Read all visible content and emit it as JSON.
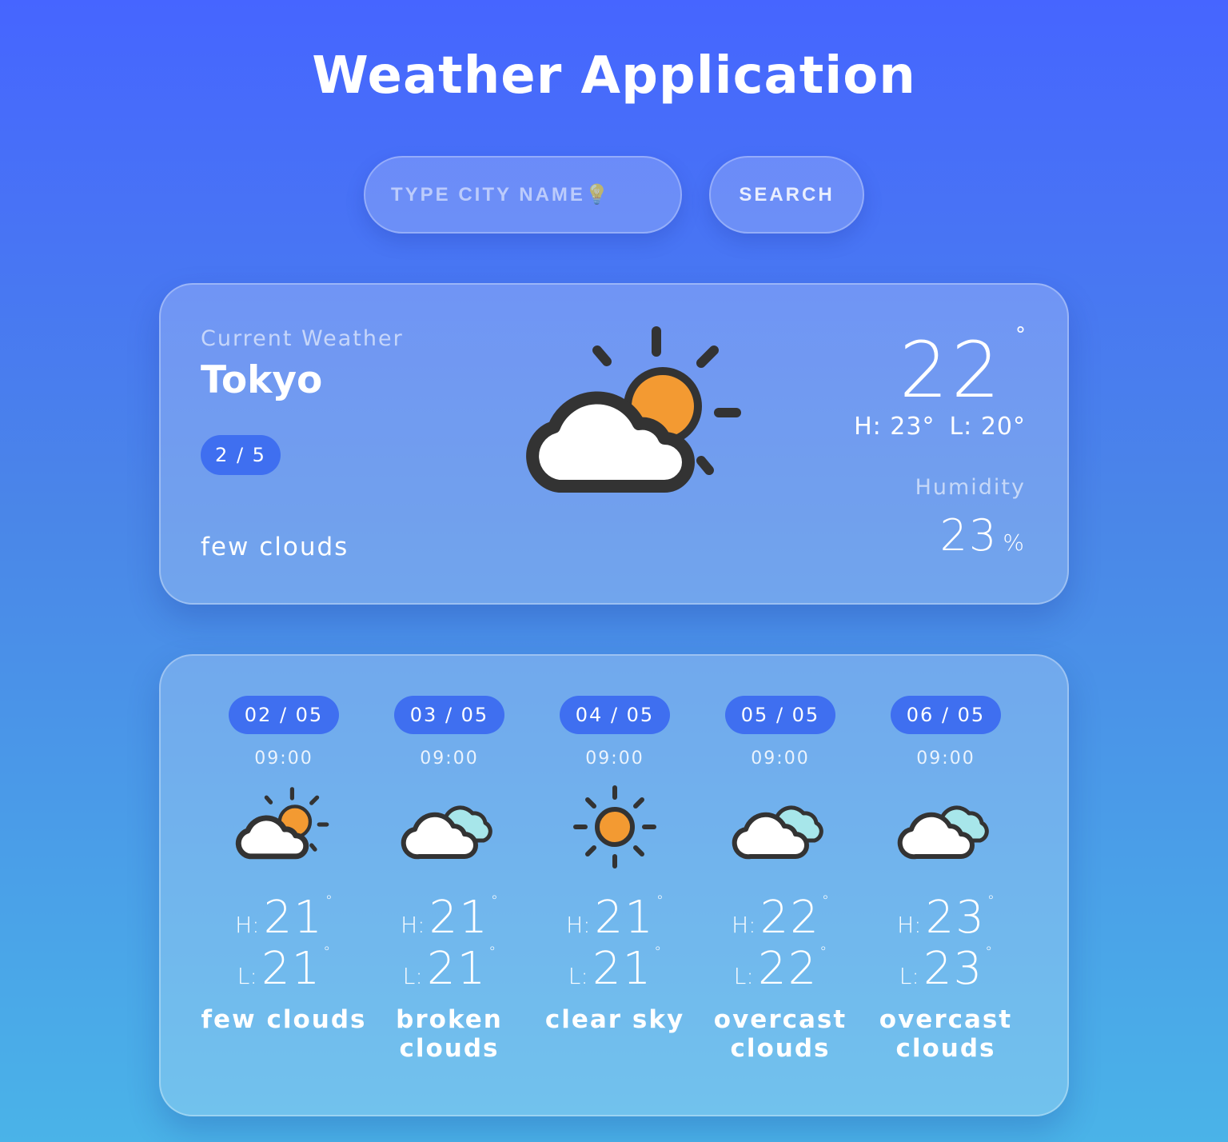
{
  "app": {
    "title": "Weather Application"
  },
  "search": {
    "placeholder": "TYPE CITY NAME💡",
    "button_label": "SEARCH"
  },
  "current": {
    "label": "Current Weather",
    "city": "Tokyo",
    "date": "2 / 5",
    "description": "few clouds",
    "icon": "partly-cloudy-icon",
    "temp": "22",
    "degree": "°",
    "high": "H: 23°",
    "low": "L: 20°",
    "humidity_label": "Humidity",
    "humidity_value": "23",
    "humidity_unit": "%"
  },
  "forecast": [
    {
      "date": "02 / 05",
      "time": "09:00",
      "icon": "partly-cloudy-icon",
      "high_label": "H:",
      "high": "21",
      "low_label": "L:",
      "low": "21",
      "deg": "°",
      "description": "few clouds"
    },
    {
      "date": "03 / 05",
      "time": "09:00",
      "icon": "broken-clouds-icon",
      "high_label": "H:",
      "high": "21",
      "low_label": "L:",
      "low": "21",
      "deg": "°",
      "description": "broken clouds"
    },
    {
      "date": "04 / 05",
      "time": "09:00",
      "icon": "sun-icon",
      "high_label": "H:",
      "high": "21",
      "low_label": "L:",
      "low": "21",
      "deg": "°",
      "description": "clear sky"
    },
    {
      "date": "05 / 05",
      "time": "09:00",
      "icon": "overcast-clouds-icon",
      "high_label": "H:",
      "high": "22",
      "low_label": "L:",
      "low": "22",
      "deg": "°",
      "description": "overcast clouds"
    },
    {
      "date": "06 / 05",
      "time": "09:00",
      "icon": "overcast-clouds-icon",
      "high_label": "H:",
      "high": "23",
      "low_label": "L:",
      "low": "23",
      "deg": "°",
      "description": "overcast clouds"
    }
  ],
  "colors": {
    "background_top": "#4665ff",
    "background_bottom": "#4ab3e8",
    "pill": "#3f6ff0",
    "sun": "#f39a32",
    "cloud_back": "#a7e6ea",
    "outline": "#333333"
  }
}
